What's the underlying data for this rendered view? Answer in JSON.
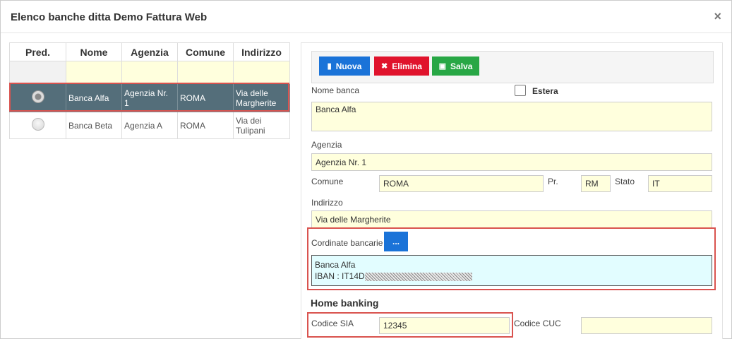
{
  "dialog": {
    "title": "Elenco banche ditta Demo Fattura Web",
    "close": "×"
  },
  "grid": {
    "columns": [
      "Pred.",
      "Nome",
      "Agenzia",
      "Comune",
      "Indirizzo"
    ],
    "rows": [
      {
        "nome": "Banca Alfa",
        "agenzia": "Agenzia Nr. 1",
        "comune": "ROMA",
        "indirizzo": "Via delle Margherite",
        "selected": true
      },
      {
        "nome": "Banca Beta",
        "agenzia": "Agenzia A",
        "comune": "ROMA",
        "indirizzo": "Via dei Tulipani",
        "selected": false
      }
    ]
  },
  "toolbar": {
    "nuova": "Nuova",
    "elimina": "Elimina",
    "salva": "Salva"
  },
  "form": {
    "nome_banca_label": "Nome banca",
    "nome_banca_value": "Banca Alfa",
    "estera_label": "Estera",
    "agenzia_label": "Agenzia",
    "agenzia_value": "Agenzia Nr. 1",
    "comune_label": "Comune",
    "comune_value": "ROMA",
    "pr_label": "Pr.",
    "pr_value": "RM",
    "stato_label": "Stato",
    "stato_value": "IT",
    "indirizzo_label": "Indirizzo",
    "indirizzo_value": "Via delle Margherite",
    "coordinate_label": "Cordinate bancarie",
    "coordinate_button": "...",
    "coordinate_line1": "Banca Alfa",
    "coordinate_line2": "IBAN : IT14D",
    "home_banking_title": "Home banking",
    "codice_sia_label": "Codice SIA",
    "codice_sia_value": "12345",
    "codice_cuc_label": "Codice CUC",
    "codice_cuc_value": ""
  },
  "colors": {
    "selected_row": "#546e7a",
    "highlight": "#d9534f",
    "input_bg": "#ffffdd",
    "coord_bg": "#e2fdff"
  }
}
